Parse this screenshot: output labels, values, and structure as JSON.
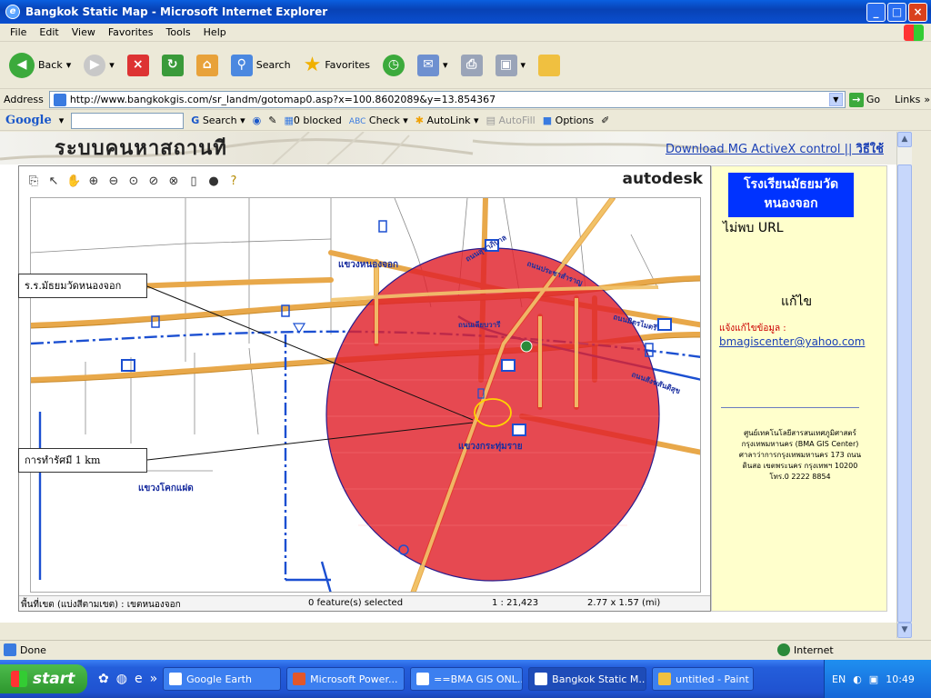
{
  "window": {
    "title": "Bangkok Static Map - Microsoft Internet Explorer",
    "controls": [
      "_",
      "□",
      "×"
    ]
  },
  "menu": [
    "File",
    "Edit",
    "View",
    "Favorites",
    "Tools",
    "Help"
  ],
  "toolbar": {
    "back_label": "Back",
    "search_label": "Search",
    "favorites_label": "Favorites"
  },
  "address": {
    "label": "Address",
    "url": "http://www.bangkokgis.com/sr_landm/gotomap0.asp?x=100.8602089&y=13.854367",
    "go_label": "Go",
    "links_label": "Links"
  },
  "googlebar": {
    "logo": "Google",
    "search_label": "Search",
    "blocked_label": "0 blocked",
    "check_label": "Check",
    "autolink_label": "AutoLink",
    "autofill_label": "AutoFill",
    "options_label": "Options"
  },
  "page": {
    "site_title": "ระบบคนหาสถานที",
    "download_link": "Download MG ActiveX control",
    "separator": "||",
    "howto_link": "วิธีใช้"
  },
  "map": {
    "brand": "autodesk",
    "labels": {
      "district_1": "แขวงหนองจอก",
      "district_2": "แขวงกระทุ่มราย",
      "district_3": "แขวงโคกแฝด",
      "road_1": "ถนนสุขาภิบาล",
      "road_2": "ถนนเลียบวารี",
      "road_3": "ถนนประชาสำราญ",
      "road_4": "ถนนมิตรไมตรี",
      "road_5": "ถนนสังฆสันติสุข"
    },
    "status": {
      "area": "พื้นที่เขต (แบ่งสีตามเขต) : เขตหนองจอก",
      "selected": "0 feature(s) selected",
      "scale": "1 : 21,423",
      "extent": "2.77 x 1.57 (mi)"
    },
    "colors": {
      "buffer_fill": "#e0212b",
      "road": "#e8a84a",
      "canal": "#1b4fd1"
    }
  },
  "callouts": {
    "school": "ร.ร.มัธยมวัดหนองจอก",
    "radius": "การทำรัศมี 1 km"
  },
  "side": {
    "school_name_line1": "โรงเรียนมัธยมวัด",
    "school_name_line2": "หนองจอก",
    "no_url": "ไม่พบ URL",
    "edit": "แก้ไข",
    "edit_info": "แจ้งแก้ไขข้อมูล :",
    "email": "bmagiscenter@yahoo.com",
    "center_line1": "ศูนย์เทคโนโลยีสารสนเทศภูมิศาสตร์",
    "center_line2": "กรุงเทพมหานคร (BMA GIS Center)",
    "center_line3": "ศาลาว่าการกรุงเทพมหานคร 173 ถนน",
    "center_line4": "ดินสอ เขตพระนคร กรุงเทพฯ 10200",
    "center_line5": "โทร.0 2222 8854"
  },
  "status": {
    "done": "Done",
    "zone": "Internet"
  },
  "taskbar": {
    "start": "start",
    "tasks": [
      "Google Earth",
      "Microsoft Power...",
      "==BMA GIS ONL...",
      "Bangkok Static M...",
      "untitled - Paint"
    ],
    "lang": "EN",
    "clock": "10:49"
  }
}
